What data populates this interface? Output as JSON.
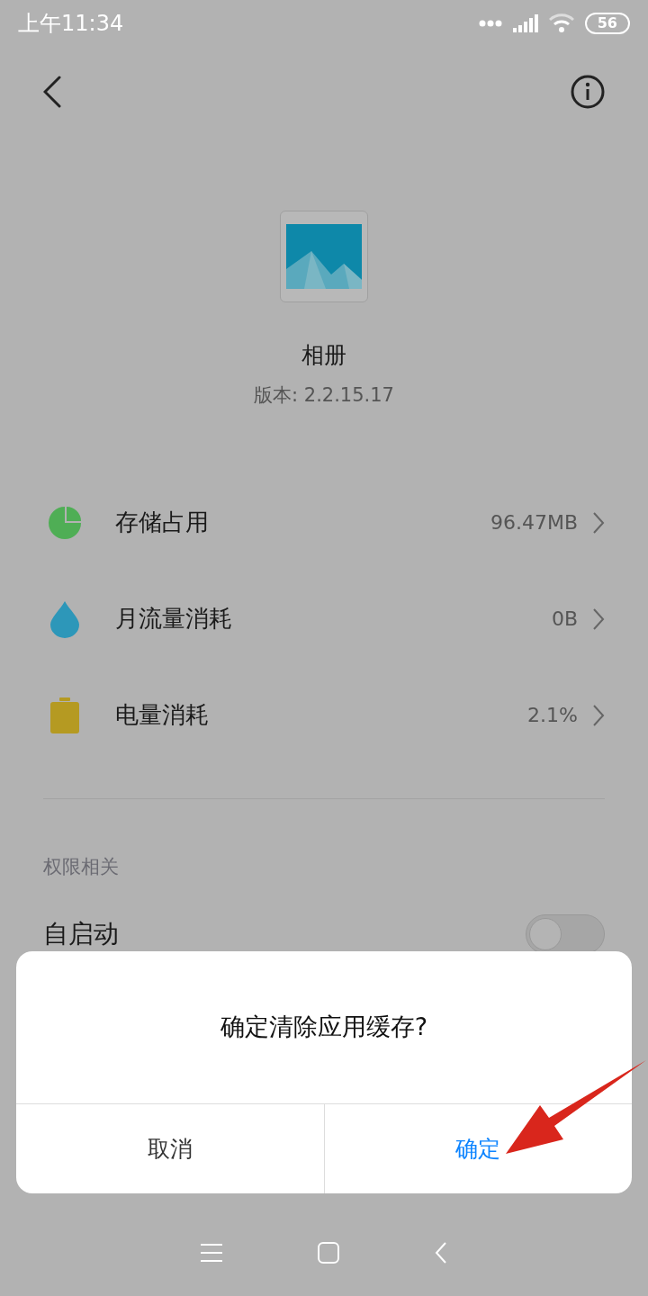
{
  "status_bar": {
    "time": "上午11:34",
    "battery": "56"
  },
  "app": {
    "name": "相册",
    "version": "版本: 2.2.15.17"
  },
  "rows": [
    {
      "kind": "storage",
      "label": "存储占用",
      "value": "96.47MB"
    },
    {
      "kind": "data",
      "label": "月流量消耗",
      "value": "0B"
    },
    {
      "kind": "battery",
      "label": "电量消耗",
      "value": "2.1%"
    }
  ],
  "section": {
    "title": "权限相关",
    "items": [
      {
        "label": "自启动",
        "on": false
      }
    ]
  },
  "dialog": {
    "message": "确定清除应用缓存?",
    "buttons": [
      {
        "label": "取消",
        "kind": "cancel"
      },
      {
        "label": "确定",
        "kind": "confirm"
      }
    ]
  }
}
